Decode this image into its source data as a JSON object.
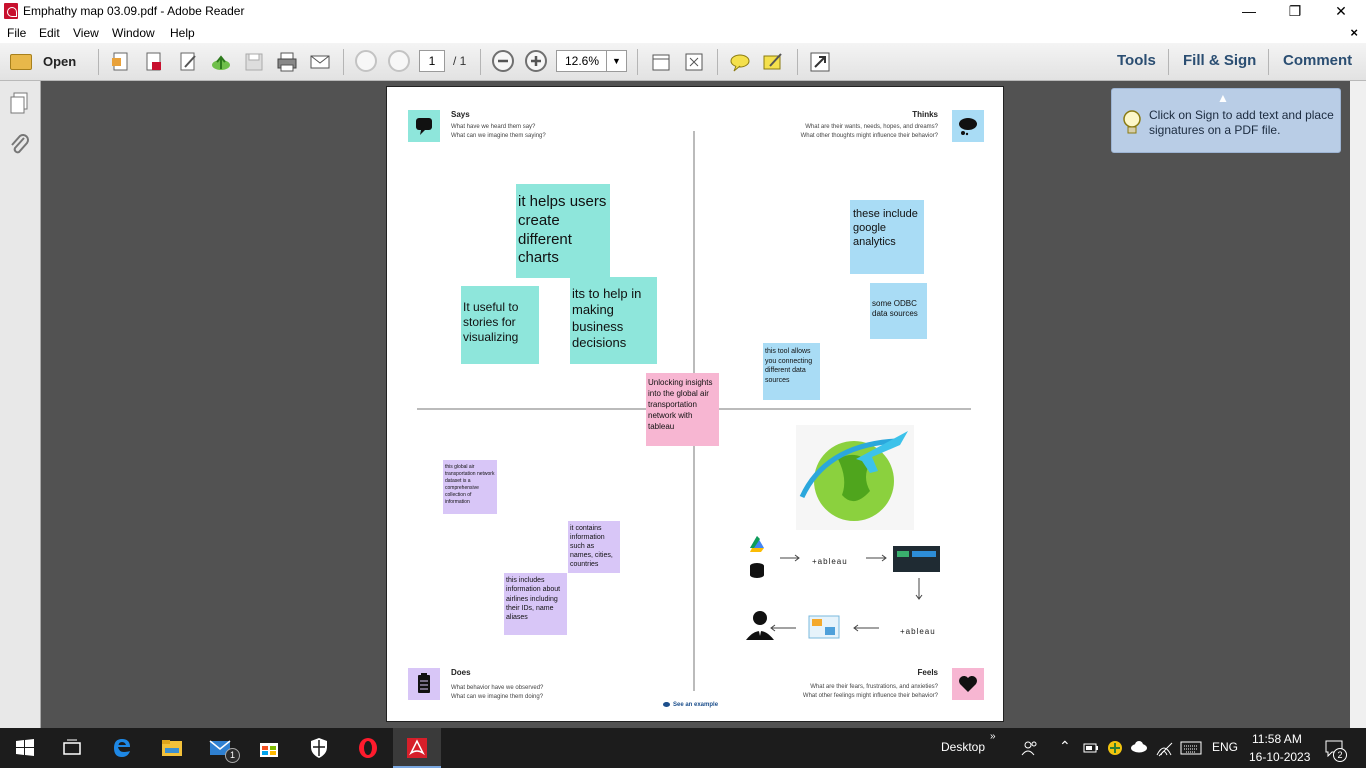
{
  "window": {
    "title": "Emphathy map 03.09.pdf - Adobe Reader",
    "minimize": "—",
    "restore": "❐",
    "close": "✕"
  },
  "menu": {
    "items": [
      "File",
      "Edit",
      "View",
      "Window",
      "Help"
    ],
    "close": "×"
  },
  "toolbar": {
    "open_label": "Open",
    "page_current": "1",
    "page_total": "/ 1",
    "zoom": "12.6%",
    "tools": "Tools",
    "fill_sign": "Fill & Sign",
    "comment": "Comment"
  },
  "tooltip": {
    "text": "Click on Sign to add text and place signatures on a PDF file."
  },
  "map": {
    "says": {
      "title": "Says",
      "q1": "What have we heard them say?",
      "q2": "What can we imagine them saying?"
    },
    "thinks": {
      "title": "Thinks",
      "q1": "What are their wants, needs, hopes, and dreams?",
      "q2": "What other thoughts might influence their behavior?"
    },
    "does": {
      "title": "Does",
      "q1": "What behavior have we observed?",
      "q2": "What can we imagine them doing?"
    },
    "feels": {
      "title": "Feels",
      "q1": "What are their fears, frustrations, and anxieties?",
      "q2": "What other feelings might influence their behavior?"
    },
    "center": "Unlocking insights into the global air transportation network with tableau",
    "says_notes": [
      "it helps users create different charts",
      "It useful to stories for visualizing",
      "its to help in making business decisions"
    ],
    "thinks_notes": [
      "these include google analytics",
      "some ODBC data sources",
      "this tool allows you connecting different data sources"
    ],
    "does_notes": [
      "this global air transportation network dataset is a comprehensive collection of information",
      "it contains information such as names, cities, countries",
      "this includes information about airlines including their IDs, name aliases"
    ],
    "tableau_label_1": "+ableau",
    "tableau_label_2": "+ableau",
    "see_example": "See an example"
  },
  "taskbar": {
    "desktop": "Desktop",
    "lang": "ENG",
    "time": "11:58 AM",
    "date": "16-10-2023",
    "mail_badge": "1",
    "notif_badge": "2"
  },
  "colors": {
    "teal": "#8ee6db",
    "blue": "#a9dcf5",
    "pink": "#f7b6d2",
    "lilac": "#d8c6f7",
    "tooltip": "#b9cde6"
  }
}
